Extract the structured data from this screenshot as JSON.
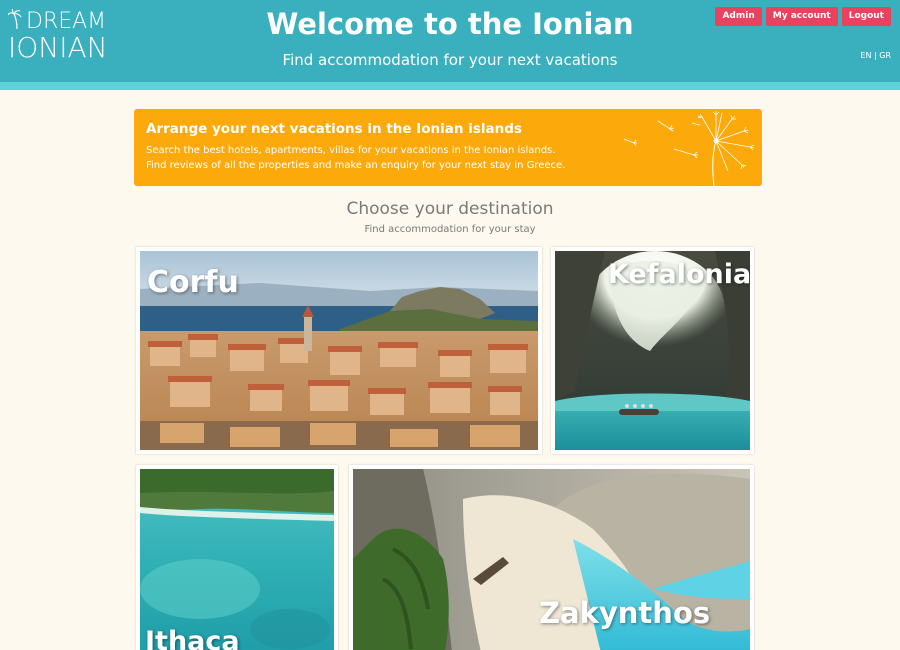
{
  "header": {
    "logo_top": "DREAM",
    "logo_bottom": "IONIAN",
    "title": "Welcome to the Ionian",
    "subtitle": "Find accommodation for your next vacations",
    "buttons": [
      "Admin",
      "My account",
      "Logout"
    ],
    "lang": "EN | GR"
  },
  "banner": {
    "title": "Arrange your next vacations in the Ionian islands",
    "line1": "Search the best hotels, apartments, villas for your vacations in the Ionian islands.",
    "line2": "Find reviews of all the properties and make an enquiry for your next stay in Greece."
  },
  "destinations": {
    "title": "Choose your destination",
    "subtitle": "Find accommodation for your stay",
    "cards": [
      "Corfu",
      "Kefalonia",
      "Ithaca",
      "Zakynthos"
    ]
  },
  "colors": {
    "header": "#3ab0bf",
    "stripe": "#5fd4d8",
    "button": "#e8425e",
    "banner": "#fcaa0b",
    "background": "#fdf9ee"
  }
}
